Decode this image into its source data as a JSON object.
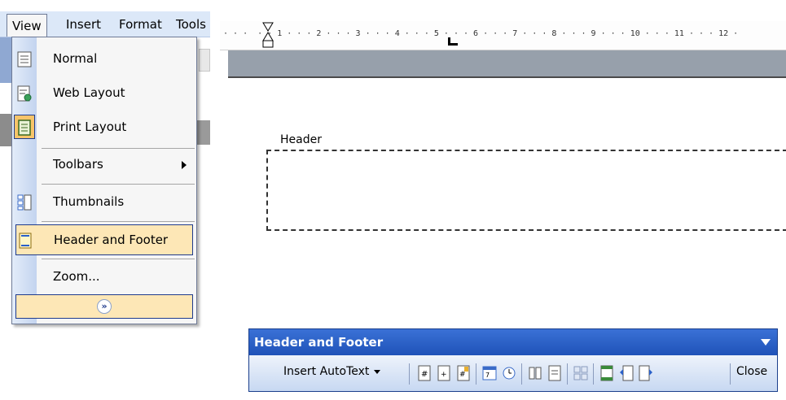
{
  "menubar": {
    "items": [
      {
        "label": "View"
      },
      {
        "label": "Insert"
      },
      {
        "label": "Format"
      },
      {
        "label": "Tools"
      }
    ]
  },
  "view_menu": {
    "items": [
      {
        "label": "Normal",
        "icon": "normal-view-icon"
      },
      {
        "label": "Web Layout",
        "icon": "web-layout-icon"
      },
      {
        "label": "Print Layout",
        "icon": "print-layout-icon"
      },
      {
        "label": "Toolbars",
        "has_submenu": true
      },
      {
        "label": "Thumbnails",
        "icon": "thumbnails-icon"
      },
      {
        "label": "Header and Footer",
        "icon": "header-footer-icon",
        "highlighted": true
      },
      {
        "label": "Zoom..."
      }
    ],
    "expand_glyph": "»"
  },
  "ruler": {
    "text": "· · ·  · · 1 · · · 2 · · · 3 · · · 4 · · · 5 · · · 6 · · · 7 · · · 8 · · · 9 · · · 10 · · · 11 · · · 12 ·"
  },
  "document": {
    "header_label": "Header"
  },
  "header_footer_toolbar": {
    "title": "Header and Footer",
    "insert_autotext_label": "Insert AutoText",
    "close_label": "Close"
  },
  "colors": {
    "toolbar_title_bg": "#2a60c8",
    "menu_highlight": "#fde7b6",
    "menu_border": "#1f3b8c"
  }
}
